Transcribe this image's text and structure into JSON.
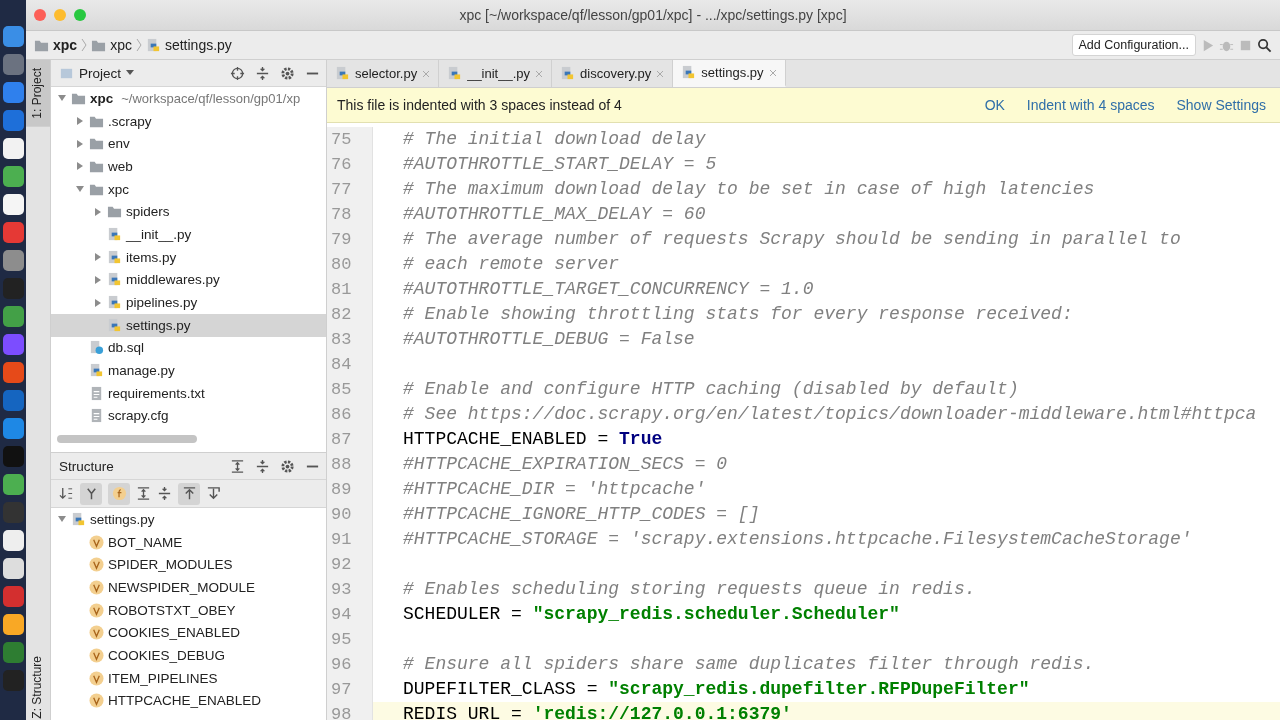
{
  "window": {
    "title": "xpc [~/workspace/qf/lesson/gp01/xpc] - .../xpc/settings.py [xpc]"
  },
  "breadcrumbs": [
    {
      "label": "xpc",
      "kind": "project"
    },
    {
      "label": "xpc",
      "kind": "folder"
    },
    {
      "label": "settings.py",
      "kind": "python"
    }
  ],
  "toolbar": {
    "run_config": "Add Configuration..."
  },
  "side_stripe": {
    "top": "1: Project",
    "bottom": "Z: Structure"
  },
  "project_panel": {
    "title": "Project",
    "tree": [
      {
        "label": "xpc",
        "path": "~/workspace/qf/lesson/gp01/xp",
        "kind": "project",
        "expanded": true,
        "selected": false,
        "children": [
          {
            "label": ".scrapy",
            "kind": "folder",
            "expanded": false,
            "selected": false
          },
          {
            "label": "env",
            "kind": "folder",
            "expanded": false,
            "selected": false
          },
          {
            "label": "web",
            "kind": "folder",
            "expanded": false,
            "selected": false
          },
          {
            "label": "xpc",
            "kind": "folder",
            "expanded": true,
            "selected": false,
            "children": [
              {
                "label": "spiders",
                "kind": "folder",
                "expanded": false,
                "selected": false
              },
              {
                "label": "__init__.py",
                "kind": "python",
                "selected": false
              },
              {
                "label": "items.py",
                "kind": "python",
                "expanded": false,
                "selected": false
              },
              {
                "label": "middlewares.py",
                "kind": "python",
                "expanded": false,
                "selected": false
              },
              {
                "label": "pipelines.py",
                "kind": "python",
                "expanded": false,
                "selected": false
              },
              {
                "label": "settings.py",
                "kind": "python",
                "selected": true
              }
            ]
          },
          {
            "label": "db.sql",
            "kind": "sql",
            "selected": false
          },
          {
            "label": "manage.py",
            "kind": "python",
            "selected": false
          },
          {
            "label": "requirements.txt",
            "kind": "text",
            "selected": false
          },
          {
            "label": "scrapy.cfg",
            "kind": "text",
            "selected": false
          }
        ]
      }
    ]
  },
  "structure_panel": {
    "title": "Structure",
    "tree": [
      {
        "label": "settings.py",
        "kind": "python",
        "expanded": true,
        "selected": false,
        "children": [
          {
            "label": "BOT_NAME",
            "kind": "variable",
            "selected": false
          },
          {
            "label": "SPIDER_MODULES",
            "kind": "variable",
            "selected": false
          },
          {
            "label": "NEWSPIDER_MODULE",
            "kind": "variable",
            "selected": false
          },
          {
            "label": "ROBOTSTXT_OBEY",
            "kind": "variable",
            "selected": false
          },
          {
            "label": "COOKIES_ENABLED",
            "kind": "variable",
            "selected": false
          },
          {
            "label": "COOKIES_DEBUG",
            "kind": "variable",
            "selected": false
          },
          {
            "label": "ITEM_PIPELINES",
            "kind": "variable",
            "selected": false
          },
          {
            "label": "HTTPCACHE_ENABLED",
            "kind": "variable",
            "selected": false
          }
        ]
      }
    ]
  },
  "editor_tabs": [
    {
      "label": "selector.py",
      "selected": false
    },
    {
      "label": "__init__.py",
      "selected": false
    },
    {
      "label": "discovery.py",
      "selected": false
    },
    {
      "label": "settings.py",
      "selected": true
    }
  ],
  "banner": {
    "message": "This file is indented with 3 spaces instead of 4",
    "actions": [
      "OK",
      "Indent with 4 spaces",
      "Show Settings"
    ]
  },
  "code": [
    {
      "number": "75",
      "current": false,
      "segments": [
        {
          "kind": "comment",
          "text": "# The initial download delay"
        }
      ]
    },
    {
      "number": "76",
      "current": false,
      "segments": [
        {
          "kind": "comment",
          "text": "#AUTOTHROTTLE_START_DELAY = 5"
        }
      ]
    },
    {
      "number": "77",
      "current": false,
      "segments": [
        {
          "kind": "comment",
          "text": "# The maximum download delay to be set in case of high latencies"
        }
      ]
    },
    {
      "number": "78",
      "current": false,
      "segments": [
        {
          "kind": "comment",
          "text": "#AUTOTHROTTLE_MAX_DELAY = 60"
        }
      ]
    },
    {
      "number": "79",
      "current": false,
      "segments": [
        {
          "kind": "comment",
          "text": "# The average number of requests Scrapy should be sending in parallel to"
        }
      ]
    },
    {
      "number": "80",
      "current": false,
      "segments": [
        {
          "kind": "comment",
          "text": "# each remote server"
        }
      ]
    },
    {
      "number": "81",
      "current": false,
      "segments": [
        {
          "kind": "comment",
          "text": "#AUTOTHROTTLE_TARGET_CONCURRENCY = 1.0"
        }
      ]
    },
    {
      "number": "82",
      "current": false,
      "segments": [
        {
          "kind": "comment",
          "text": "# Enable showing throttling stats for every response received:"
        }
      ]
    },
    {
      "number": "83",
      "current": false,
      "segments": [
        {
          "kind": "comment",
          "text": "#AUTOTHROTTLE_DEBUG = False"
        }
      ]
    },
    {
      "number": "84",
      "current": false
    },
    {
      "number": "85",
      "current": false,
      "segments": [
        {
          "kind": "comment",
          "text": "# Enable and configure HTTP caching (disabled by default)"
        }
      ]
    },
    {
      "number": "86",
      "current": false,
      "segments": [
        {
          "kind": "comment",
          "text": "# See https://doc.scrapy.org/en/latest/topics/downloader-middleware.html#httpca"
        }
      ]
    },
    {
      "number": "87",
      "current": false,
      "segments": [
        {
          "kind": "plain",
          "text": "HTTPCACHE_ENABLED = "
        },
        {
          "kind": "keyword",
          "text": "True"
        }
      ]
    },
    {
      "number": "88",
      "current": false,
      "segments": [
        {
          "kind": "comment",
          "text": "#HTTPCACHE_EXPIRATION_SECS = 0"
        }
      ]
    },
    {
      "number": "89",
      "current": false,
      "segments": [
        {
          "kind": "comment",
          "text": "#HTTPCACHE_DIR = 'httpcache'"
        }
      ]
    },
    {
      "number": "90",
      "current": false,
      "segments": [
        {
          "kind": "comment",
          "text": "#HTTPCACHE_IGNORE_HTTP_CODES = []"
        }
      ]
    },
    {
      "number": "91",
      "current": false,
      "segments": [
        {
          "kind": "comment",
          "text": "#HTTPCACHE_STORAGE = 'scrapy.extensions.httpcache.FilesystemCacheStorage'"
        }
      ]
    },
    {
      "number": "92",
      "current": false
    },
    {
      "number": "93",
      "current": false,
      "segments": [
        {
          "kind": "comment",
          "text": "# Enables scheduling storing requests queue in redis."
        }
      ]
    },
    {
      "number": "94",
      "current": false,
      "segments": [
        {
          "kind": "plain",
          "text": "SCHEDULER = "
        },
        {
          "kind": "string",
          "text": "\"scrapy_redis.scheduler.Scheduler\""
        }
      ]
    },
    {
      "number": "95",
      "current": false
    },
    {
      "number": "96",
      "current": false,
      "segments": [
        {
          "kind": "comment",
          "text": "# Ensure all spiders share same duplicates filter through redis."
        }
      ]
    },
    {
      "number": "97",
      "current": false,
      "segments": [
        {
          "kind": "plain",
          "text": "DUPEFILTER_CLASS = "
        },
        {
          "kind": "string",
          "text": "\"scrapy_redis.dupefilter.RFPDupeFilter\""
        }
      ]
    },
    {
      "number": "98",
      "current": true,
      "segments": [
        {
          "kind": "plain",
          "text": "REDIS_URL = "
        },
        {
          "kind": "string",
          "text": "'redis://127.0.0.1:6379'"
        }
      ]
    }
  ]
}
